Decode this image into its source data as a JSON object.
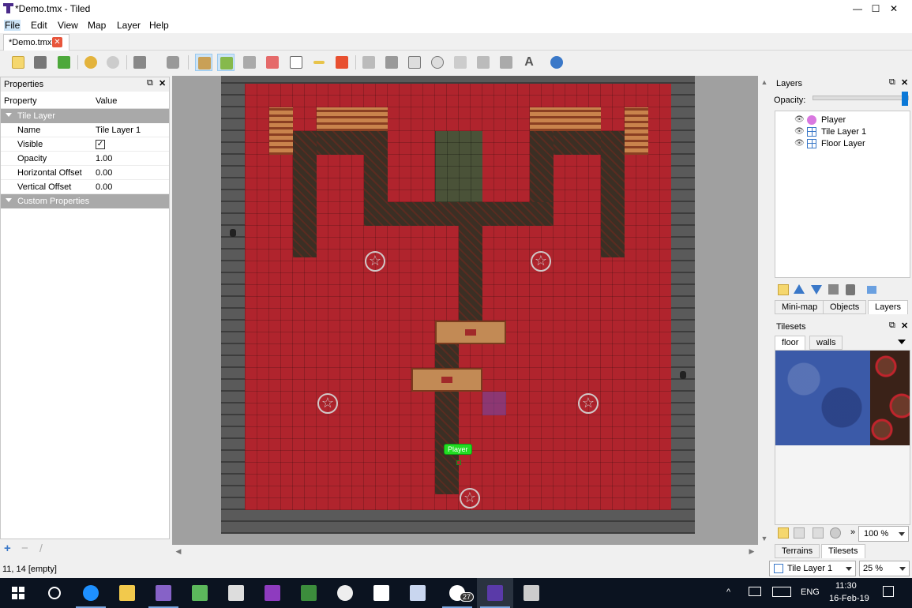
{
  "window": {
    "title": "*Demo.tmx - Tiled",
    "minimize": "—",
    "maximize": "☐",
    "close": "✕"
  },
  "menubar": {
    "items": [
      "File",
      "Edit",
      "View",
      "Map",
      "Layer",
      "Help"
    ]
  },
  "document_tab": {
    "label": "*Demo.tmx",
    "close": "✕"
  },
  "toolbar": {
    "icons": [
      "new-map-icon",
      "open-icon",
      "save-icon",
      "undo-icon",
      "redo-icon",
      "command-icon",
      "random-icon",
      "stamp-brush-icon",
      "terrain-brush-icon",
      "bucket-fill-icon",
      "eraser-icon",
      "rectangle-select-icon",
      "magic-wand-icon",
      "select-same-tile-icon",
      "select-objects-icon",
      "edit-polygons-icon",
      "insert-rectangle-icon",
      "insert-ellipse-icon",
      "insert-polygon-icon",
      "insert-polyline-icon",
      "insert-tile-icon",
      "insert-text-icon",
      "move-icon"
    ]
  },
  "properties_panel": {
    "title": "Properties",
    "col_property": "Property",
    "col_value": "Value",
    "group_tile_layer": "Tile Layer",
    "rows": [
      {
        "key": "Name",
        "value": "Tile Layer 1"
      },
      {
        "key": "Visible",
        "value": "✓"
      },
      {
        "key": "Opacity",
        "value": "1.00"
      },
      {
        "key": "Horizontal Offset",
        "value": "0.00"
      },
      {
        "key": "Vertical Offset",
        "value": "0.00"
      }
    ],
    "group_custom": "Custom Properties",
    "add": "+",
    "remove": "−",
    "rename": "/"
  },
  "status": {
    "position": "11, 14 [empty]",
    "current_layer": "Tile Layer 1",
    "zoom": "25 %"
  },
  "map": {
    "player_label": "Player"
  },
  "layers_panel": {
    "title": "Layers",
    "opacity_label": "Opacity:",
    "opacity_value": 1.0,
    "layers": [
      {
        "name": "Player",
        "type": "object"
      },
      {
        "name": "Tile Layer 1",
        "type": "tile"
      },
      {
        "name": "Floor Layer",
        "type": "tile"
      }
    ],
    "tabs": [
      "Mini-map",
      "Objects",
      "Layers"
    ],
    "selected_tab": "Layers"
  },
  "tilesets_panel": {
    "title": "Tilesets",
    "tabs": [
      "floor",
      "walls"
    ],
    "selected_tab": "floor",
    "zoom": "100 %",
    "bottom_tabs": [
      "Terrains",
      "Tilesets"
    ],
    "selected_bottom_tab": "Tilesets"
  },
  "taskbar": {
    "apps": [
      "start-icon",
      "search-icon",
      "edge-icon",
      "file-explorer-icon",
      "visual-studio-icon",
      "paint-icon",
      "calculator-icon",
      "onenote-icon",
      "game-icon",
      "maps-icon",
      "store-icon",
      "snipping-icon",
      "telegram-icon",
      "tiled-icon",
      "network-app-icon"
    ],
    "telegram_badge": "27",
    "language": "ENG",
    "time": "11:30",
    "date": "16-Feb-19"
  },
  "colors": {
    "accent": "#0a78d7",
    "floor_red": "#b0242d",
    "player_green": "#22dd22",
    "taskbar": "#0b1320"
  }
}
